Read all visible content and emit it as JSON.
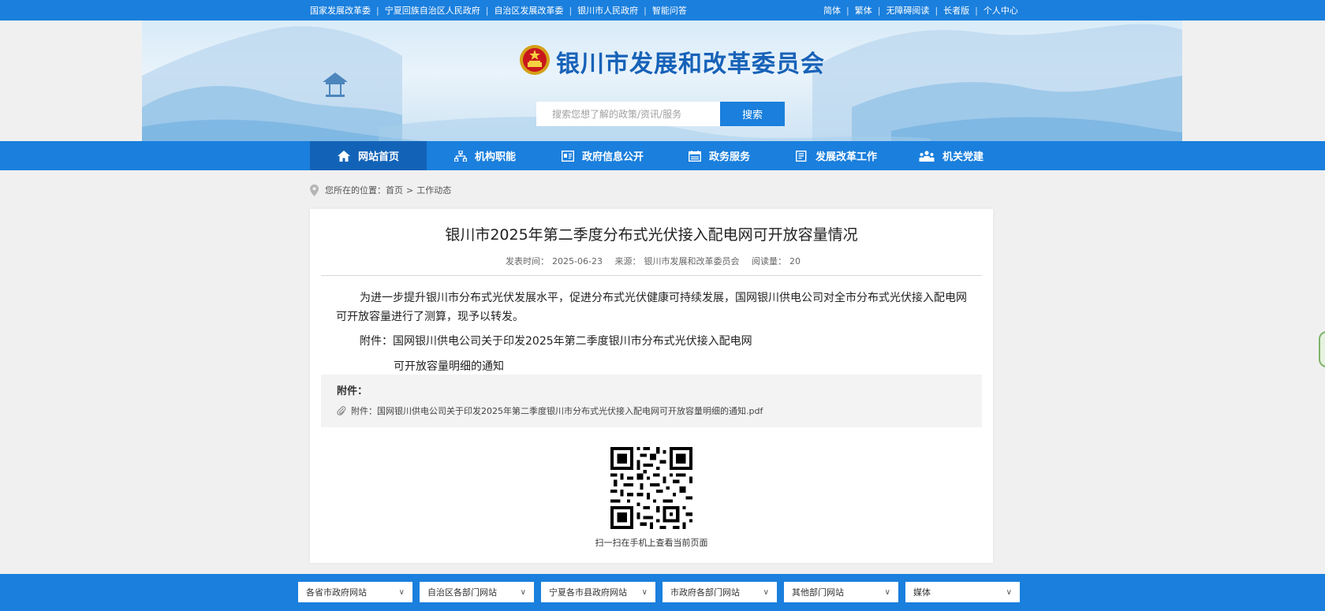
{
  "topbar": {
    "left_links": [
      "国家发展改革委",
      "宁夏回族自治区人民政府",
      "自治区发展改革委",
      "银川市人民政府",
      "智能问答"
    ],
    "right_links": [
      "简体",
      "繁体",
      "无障碍阅读",
      "长者版",
      "个人中心"
    ]
  },
  "header": {
    "site_title": "银川市发展和改革委员会",
    "search_placeholder": "搜索您想了解的政策/资讯/服务",
    "search_button": "搜索"
  },
  "nav": {
    "items": [
      {
        "label": "网站首页",
        "icon": "home-icon",
        "active": true
      },
      {
        "label": "机构职能",
        "icon": "org-chart-icon",
        "active": false
      },
      {
        "label": "政府信息公开",
        "icon": "id-card-icon",
        "active": false
      },
      {
        "label": "政务服务",
        "icon": "calendar-icon",
        "active": false
      },
      {
        "label": "发展改革工作",
        "icon": "document-icon",
        "active": false
      },
      {
        "label": "机关党建",
        "icon": "people-icon",
        "active": false
      }
    ]
  },
  "breadcrumb": {
    "prefix": "您所在的位置：",
    "home": "首页",
    "arrow": ">",
    "current": "工作动态"
  },
  "article": {
    "title": "银川市2025年第二季度分布式光伏接入配电网可开放容量情况",
    "publish_label": "发表时间：",
    "publish_date": "2025-06-23",
    "source_label": "来源：",
    "source": "银川市发展和改革委员会",
    "views_label": "阅读量：",
    "views": "20",
    "body": "为进一步提升银川市分布式光伏发展水平，促进分布式光伏健康可持续发展，国网银川供电公司对全市分布式光伏接入配电网可开放容量进行了测算，现予以转发。",
    "annex_line1": "附件：国网银川供电公司关于印发2025年第二季度银川市分布式光伏接入配电网",
    "annex_line2": "可开放容量明细的通知",
    "attachments_title": "附件：",
    "attachment_file": "附件：国网银川供电公司关于印发2025年第二季度银川市分布式光伏接入配电网可开放容量明细的通知.pdf",
    "qr_caption": "扫一扫在手机上查看当前页面"
  },
  "footer": {
    "selects": [
      "各省市政府网站",
      "自治区各部门网站",
      "宁夏各市县政府网站",
      "市政府各部门网站",
      "其他部门网站",
      "媒体"
    ]
  },
  "colors": {
    "primary": "#1a7fdd",
    "nav_active": "#1263b8",
    "title_blue": "#1762b8"
  }
}
